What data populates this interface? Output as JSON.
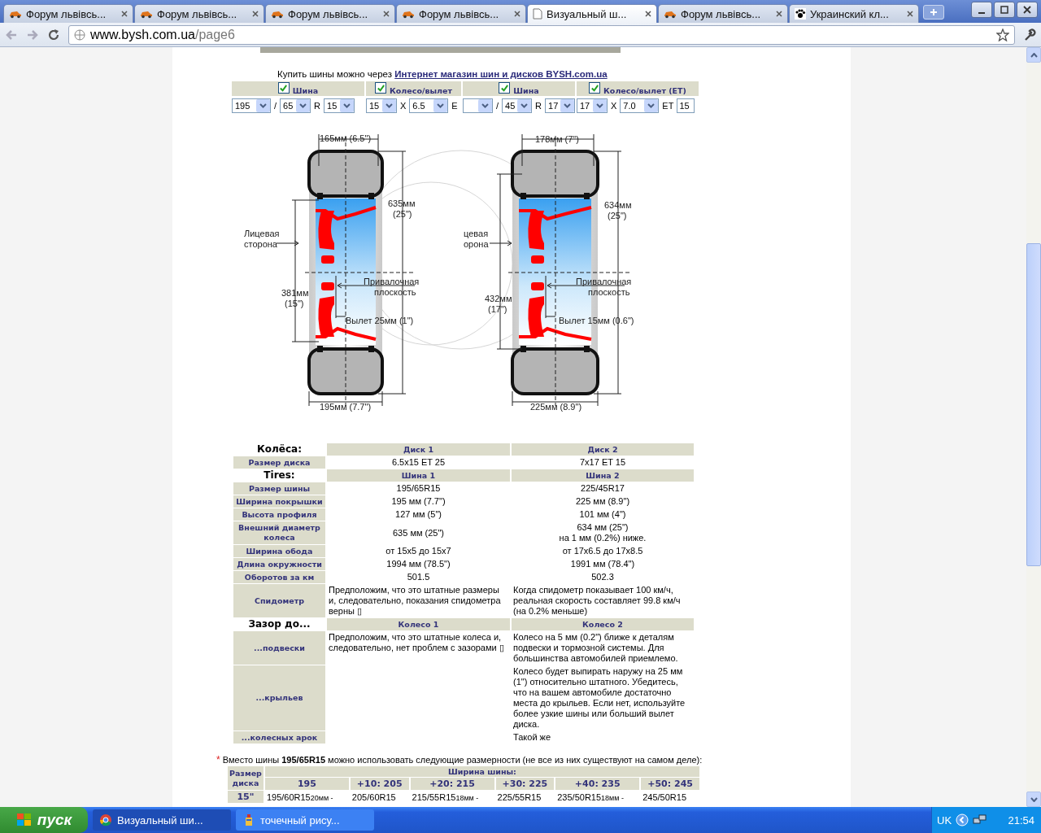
{
  "browser": {
    "tabs": [
      {
        "kind": "forum",
        "title": "Форум львівсь...",
        "selected": false
      },
      {
        "kind": "forum",
        "title": "Форум львівсь...",
        "selected": false
      },
      {
        "kind": "forum",
        "title": "Форум львівсь...",
        "selected": false
      },
      {
        "kind": "forum",
        "title": "Форум львівсь...",
        "selected": false
      },
      {
        "kind": "calculator",
        "title": "Визуальный ш...",
        "selected": true
      },
      {
        "kind": "forum",
        "title": "Форум львівсь...",
        "selected": false
      },
      {
        "kind": "club",
        "title": "Украинский кл...",
        "selected": false
      }
    ],
    "address": {
      "host": "www.bysh.com.ua",
      "path": "/page6"
    }
  },
  "page": {
    "buy": {
      "text": "Купить шины можно через",
      "link": "Интернет магазин шин и дисков BYSH.com.ua"
    },
    "selectors": [
      {
        "label": "Шина",
        "checked": true,
        "fields": [
          {
            "kind": "select",
            "value": "195"
          },
          {
            "kind": "sep",
            "value": "/"
          },
          {
            "kind": "select",
            "value": "65"
          },
          {
            "kind": "sep",
            "value": "R"
          },
          {
            "kind": "select",
            "value": "15"
          }
        ]
      },
      {
        "label": "Колесо/вылет",
        "checked": true,
        "fields": [
          {
            "kind": "select",
            "value": "15"
          },
          {
            "kind": "sep",
            "value": "X"
          },
          {
            "kind": "select",
            "value": "6.5"
          },
          {
            "kind": "sep",
            "value": "E"
          }
        ]
      },
      {
        "label": "Шина",
        "checked": true,
        "fields": [
          {
            "kind": "select"
          },
          {
            "kind": "sep",
            "value": "/"
          },
          {
            "kind": "select",
            "value": "45"
          },
          {
            "kind": "sep",
            "value": "R"
          },
          {
            "kind": "select",
            "value": "17"
          }
        ]
      },
      {
        "label": "Колесо/вылет (ET)",
        "checked": true,
        "fields": [
          {
            "kind": "select",
            "value": "17"
          },
          {
            "kind": "sep",
            "value": "X"
          },
          {
            "kind": "select",
            "value": "7.0"
          },
          {
            "kind": "sep",
            "value": "ET"
          },
          {
            "kind": "input",
            "value": "15"
          }
        ]
      }
    ],
    "wheels": [
      {
        "width_top": "165мм (6.5\")",
        "outer_diameter": [
          "635мм",
          "(25\")"
        ],
        "face_label": [
          "Лицевая",
          "сторона"
        ],
        "rim_diameter": [
          "381мм",
          "(15\")"
        ],
        "mount_label": [
          "Привалочная",
          "плоскость"
        ],
        "offset": "Вылет 25мм (1\")",
        "width_bottom": "195мм (7.7\")"
      },
      {
        "width_top": "178мм (7\")",
        "outer_diameter": [
          "634мм",
          "(25\")"
        ],
        "face_label": [
          "цевая",
          "орона"
        ],
        "rim_diameter": [
          "432мм",
          "(17\")"
        ],
        "mount_label": [
          "Привалочная",
          "плоскость"
        ],
        "offset": "Вылет 15мм (0.6\")",
        "width_bottom": "225мм (8.9\")"
      }
    ],
    "specs": [
      {
        "title": "Колёса:",
        "columns": [
          "Диск 1",
          "Диск 2"
        ],
        "rows": [
          {
            "label": "Размер диска",
            "kind": "value",
            "value_1": "6.5x15 ET 25",
            "value_2": "7x17 ET 15"
          }
        ]
      },
      {
        "title": "Tires:",
        "columns": [
          "Шина 1",
          "Шина 2"
        ],
        "rows": [
          {
            "label": "Размер шины",
            "kind": "value",
            "value_1": "195/65R15",
            "value_2": "225/45R17"
          },
          {
            "label": "Ширина покрышки",
            "kind": "value",
            "value_1": "195 мм (7.7\")",
            "value_2": "225 мм (8.9\")"
          },
          {
            "label": "Высота профиля",
            "kind": "value",
            "value_1": "127 мм (5\")",
            "value_2": "101 мм (4\")"
          },
          {
            "label": "Внешний диаметр колеса",
            "kind": "value",
            "value_1": "635 мм (25\")",
            "value_2": "634 мм (25\")\nна 1 мм (0.2%) ниже."
          },
          {
            "label": "Ширина обода",
            "kind": "value",
            "value_1": "от 15x5 до 15x7",
            "value_2": "от 17x6.5 до 17x8.5"
          },
          {
            "label": "Длина окружности",
            "kind": "value",
            "value_1": "1994 мм (78.5\")",
            "value_2": "1991 мм (78.4\")"
          },
          {
            "label": "Оборотов за км",
            "kind": "value",
            "value_1": "501.5",
            "value_2": "502.3"
          },
          {
            "label": "Спидометр",
            "kind": "note",
            "value_1": "Предположим, что это штатные размеры и, следовательно, показания спидометра верны ▯",
            "value_2": "Когда спидометр показывает 100 км/ч, реальная скорость составляет 99.8 км/ч (на 0.2% меньше)"
          }
        ]
      },
      {
        "title": "Зазор до...",
        "columns": [
          "Колесо 1",
          "Колесо 2"
        ],
        "rows": [
          {
            "label": "...подвески",
            "kind": "note",
            "value_1": "Предположим, что это штатные колеса и, следовательно, нет проблем с зазорами ▯",
            "value_2": "Колесо на 5 мм (0.2\") ближе к деталям подвески и тормозной системы. Для большинства автомобилей приемлемо."
          },
          {
            "label": "...крыльев",
            "kind": "note",
            "value_2": "Колесо будет выпирать наружу на 25 мм (1\") относительно штатного. Убедитесь, что на вашем автомобиле достаточно места до крыльев. Если нет, используйте более узкие шины или больший вылет диска."
          },
          {
            "label": "...колесных арок",
            "kind": "note",
            "value_2": "Такой же"
          }
        ]
      }
    ],
    "footnote": {
      "mark": "*",
      "text": "Вместо шины **195/65R15** можно использовать следующие размерности (не все из них существуют на самом деле):"
    },
    "sizes": {
      "row_header": "Размер диска",
      "group_header": "Ширина шины:",
      "columns": [
        "195",
        "+10: 205",
        "+20: 215",
        "+30: 225",
        "+40: 235",
        "+50: 245"
      ],
      "rows": [
        {
          "rim": "15\"",
          "cells": [
            {
              "size": "195/60R15",
              "note": "20мм -"
            },
            {
              "size": "205/60R15"
            },
            {
              "size": "215/55R15",
              "note": "18мм -"
            },
            {
              "size": "225/55R15"
            },
            {
              "size": "235/50R15",
              "note": "18мм -"
            },
            {
              "size": "245/50R15"
            }
          ]
        }
      ]
    }
  },
  "taskbar": {
    "start": "пуск",
    "tasks": [
      {
        "kind": "browser",
        "title": "Визуальный ши...",
        "selected": true
      },
      {
        "kind": "editor",
        "title": "точечный рису...",
        "selected": false
      }
    ],
    "tray": {
      "language": "UK",
      "time": "21:54"
    }
  }
}
